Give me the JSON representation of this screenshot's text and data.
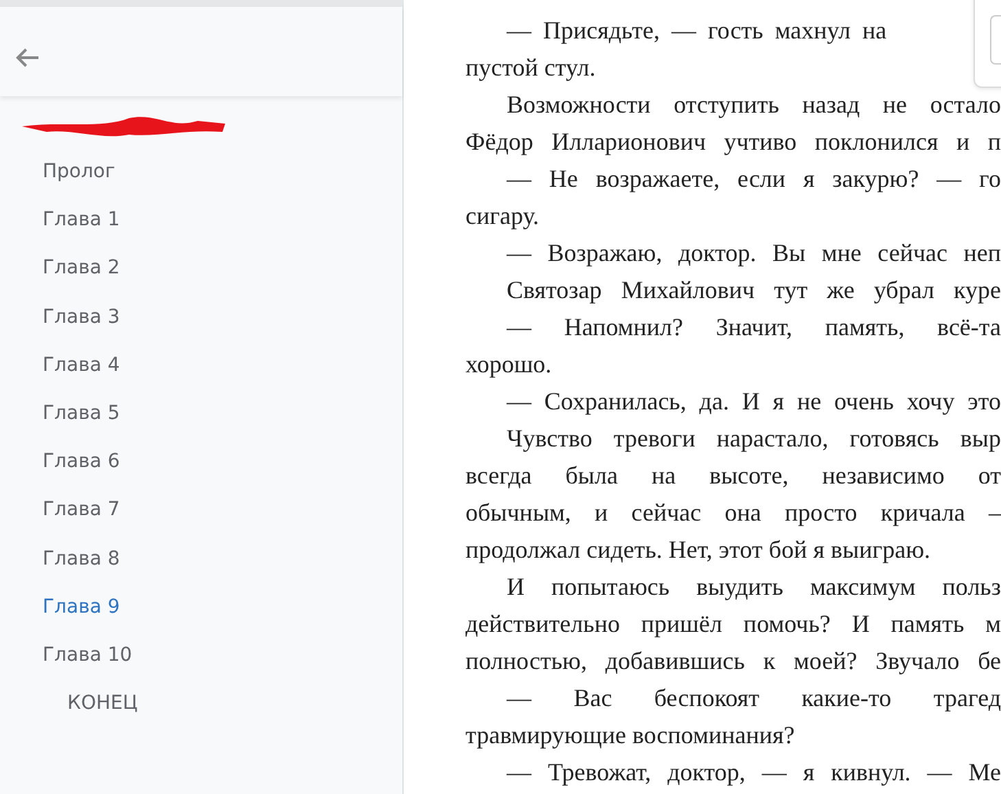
{
  "sidebar": {
    "title": {
      "redacted": true
    },
    "items": [
      {
        "label": "Пролог",
        "selected": false
      },
      {
        "label": "Глава 1",
        "selected": false
      },
      {
        "label": "Глава 2",
        "selected": false
      },
      {
        "label": "Глава 3",
        "selected": false
      },
      {
        "label": "Глава 4",
        "selected": false
      },
      {
        "label": "Глава 5",
        "selected": false
      },
      {
        "label": "Глава 6",
        "selected": false
      },
      {
        "label": "Глава 7",
        "selected": false
      },
      {
        "label": "Глава 8",
        "selected": false
      },
      {
        "label": "Глава 9",
        "selected": true
      },
      {
        "label": "Глава 10",
        "selected": false,
        "children": [
          {
            "label": "КОНЕЦ",
            "selected": false
          }
        ]
      }
    ]
  },
  "text_lines": [
    {
      "text": "— Присядьте, — гость махнул на",
      "indent": true
    },
    {
      "text": "пустой стул.",
      "indent": false
    },
    {
      "text": "Возможности отступить назад не остало",
      "indent": true,
      "justified": true
    },
    {
      "text": "Фёдор Илларионович учтиво поклонился и п",
      "indent": false,
      "justified": true
    },
    {
      "text": "— Не возражаете, если я закурю? — го",
      "indent": true,
      "justified": true
    },
    {
      "text": "сигару.",
      "indent": false
    },
    {
      "text": "— Возражаю, доктор. Вы мне сейчас неп",
      "indent": true,
      "justified": true
    },
    {
      "text": "Святозар Михайлович тут же убрал куре",
      "indent": true,
      "justified": true
    },
    {
      "text": "— Напомнил? Значит, память, всё-та",
      "indent": true,
      "justified": true
    },
    {
      "text": "хорошо.",
      "indent": false
    },
    {
      "text": "— Сохранилась, да. И я не очень хочу это",
      "indent": true,
      "justified": true
    },
    {
      "text": "Чувство тревоги нарастало, готовясь выр",
      "indent": true,
      "justified": true
    },
    {
      "text": "всегда была на высоте, независимо от",
      "indent": false,
      "justified": true
    },
    {
      "text": "обычным, и сейчас она просто кричала –",
      "indent": false,
      "justified": true
    },
    {
      "text": "продолжал сидеть. Нет, этот бой я выиграю.",
      "indent": false
    },
    {
      "text": "И попытаюсь выудить максимум польз",
      "indent": true,
      "justified": true
    },
    {
      "text": "действительно пришёл помочь? И память м",
      "indent": false,
      "justified": true
    },
    {
      "text": "полностью, добавившись к моей? Звучало бе",
      "indent": false,
      "justified": true
    },
    {
      "text": "— Вас беспокоят какие-то трагед",
      "indent": true,
      "justified": true
    },
    {
      "text": "травмирующие воспоминания?",
      "indent": false
    },
    {
      "text": "— Тревожат, доктор, — я кивнул. — Ме",
      "indent": true,
      "justified": true
    }
  ]
}
